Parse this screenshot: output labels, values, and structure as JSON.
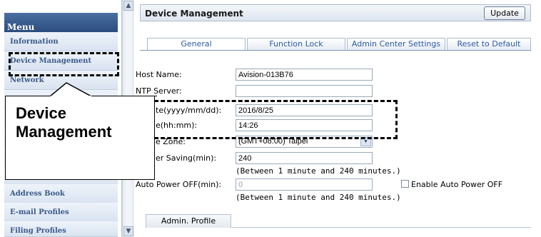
{
  "sidebar": {
    "menu_header": "Menu",
    "items": [
      {
        "label": "Information"
      },
      {
        "label": "Device Management"
      },
      {
        "label": "Network"
      },
      {
        "label": "Address Book"
      },
      {
        "label": "E-mail Profiles"
      },
      {
        "label": "Filing Profiles"
      }
    ]
  },
  "header": {
    "title": "Device Management",
    "update_label": "Update"
  },
  "tabs": [
    {
      "label": "General",
      "active": true
    },
    {
      "label": "Function Lock",
      "active": false
    },
    {
      "label": "Admin Center Settings",
      "active": false
    },
    {
      "label": "Reset to Default",
      "active": false
    }
  ],
  "form": {
    "host_name": {
      "label": "Host Name:",
      "value": "Avision-013B76"
    },
    "ntp_server": {
      "label": "NTP Server:",
      "value": ""
    },
    "date": {
      "label": "Date(yyyy/mm/dd):",
      "label_visible": "te(yyyy/mm/dd):",
      "value": "2016/8/25"
    },
    "time": {
      "label": "Time(hh:mm):",
      "label_visible": "e(hh:mm):",
      "value": "14:26"
    },
    "time_zone": {
      "label": "Time Zone:",
      "label_visible": "e Zone:",
      "value": "(GMT+08:00) Taipei"
    },
    "power_saving": {
      "label": "Power Saving(min):",
      "label_visible": "er Saving(min):",
      "value": "240",
      "hint": "(Between 1 minute and 240 minutes.)"
    },
    "auto_power_off": {
      "label": "Auto Power OFF(min):",
      "value": "0",
      "hint": "(Between 1 minute and 240 minutes.)",
      "checkbox_label": "Enable Auto Power OFF",
      "checked": false
    }
  },
  "admin_profile_tab": "Admin. Profile",
  "callout": {
    "line1": "Device",
    "line2": "Management"
  },
  "colors": {
    "menu_header": "#2b4c7e",
    "tab_text": "#2d5aa6",
    "sidebar_text": "#3b5a8a"
  }
}
